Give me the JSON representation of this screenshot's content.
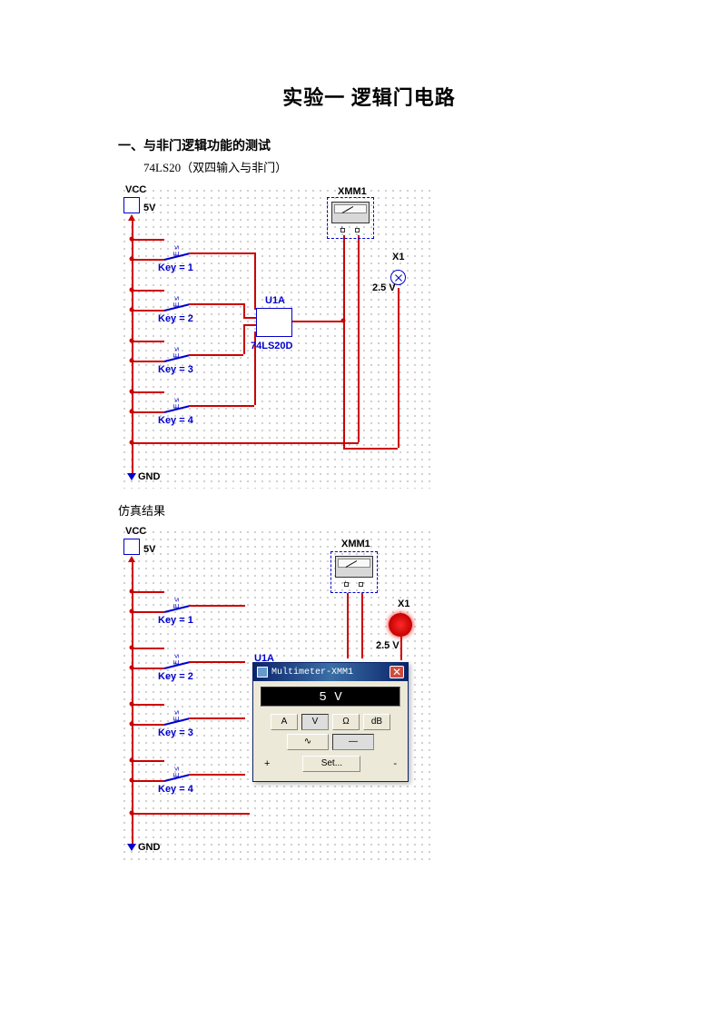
{
  "title": "实验一  逻辑门电路",
  "section1": {
    "heading": "一、与非门逻辑功能的测试",
    "chip_desc": "74LS20（双四输入与非门）"
  },
  "circuit": {
    "vcc": "VCC",
    "v5": "5V",
    "gnd": "GND",
    "key_prefix": "Key = ",
    "keys": [
      "1",
      "2",
      "3",
      "4"
    ],
    "u1a": "U1A",
    "chip_label": "74LS20D",
    "xmm1": "XMM1",
    "x1": "X1",
    "v2_5": "2.5 V",
    "pin_plus": "+",
    "pin_minus": "–"
  },
  "sim_caption": "仿真结果",
  "multimeter": {
    "title": "Multimeter-XMM1",
    "display": "5 V",
    "btn_A": "A",
    "btn_V": "V",
    "btn_Ohm": "Ω",
    "btn_dB": "dB",
    "btn_ac": "∿",
    "btn_dc": "—",
    "btn_set": "Set...",
    "plus": "+",
    "minus": "-"
  }
}
